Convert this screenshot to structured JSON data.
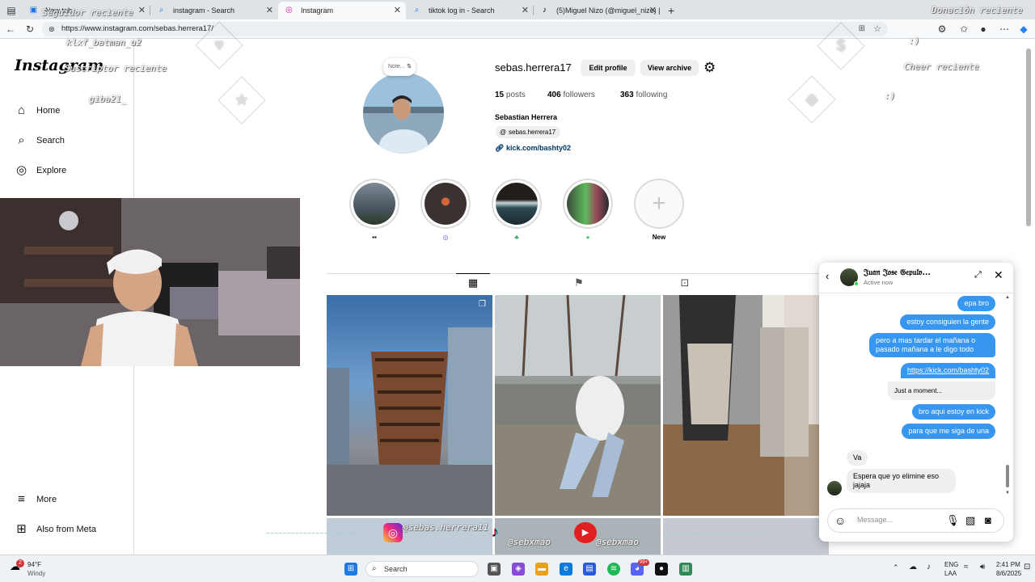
{
  "browser": {
    "tabs": [
      {
        "title": "New tab",
        "icon": "newtab-icon"
      },
      {
        "title": "instagram - Search",
        "icon": "search-icon"
      },
      {
        "title": "Instagram",
        "icon": "instagram-icon",
        "active": true
      },
      {
        "title": "tiktok log in - Search",
        "icon": "search-icon"
      },
      {
        "title": "(5)Miguel Nizo (@miguel_nizo) |",
        "icon": "tiktok-icon"
      }
    ],
    "url": "https://www.instagram.com/sebas.herrera17/"
  },
  "sidebar": {
    "logo": "Instagram",
    "items": [
      {
        "label": "Home",
        "icon": "home-icon"
      },
      {
        "label": "Search",
        "icon": "search-icon"
      },
      {
        "label": "Explore",
        "icon": "compass-icon"
      },
      {
        "label": "More",
        "icon": "hamburger-icon"
      },
      {
        "label": "Also from Meta",
        "icon": "meta-icon"
      }
    ]
  },
  "profile": {
    "note": "Note...",
    "username": "sebas.herrera17",
    "edit_profile": "Edit profile",
    "view_archive": "View archive",
    "posts_count": "15",
    "posts_label": "posts",
    "followers_count": "406",
    "followers_label": "followers",
    "following_count": "363",
    "following_label": "following",
    "full_name": "Sebastian Herrera",
    "threads_handle": "sebas.herrera17",
    "link": "kick.com/bashty02",
    "highlights": [
      {
        "label": "▪▪"
      },
      {
        "label": "◎"
      },
      {
        "label": "♣"
      },
      {
        "label": "●"
      },
      {
        "label": "New"
      }
    ]
  },
  "dm": {
    "contact_name": "𝔍𝔲𝔞𝔫 𝔍𝔬𝔰𝔢 𝔊𝔢𝔭𝔲𝔩𝔳...",
    "status": "Active now",
    "messages": [
      {
        "text": "epa bro",
        "dir": "out"
      },
      {
        "text": "estoy consiguien la gente",
        "dir": "out"
      },
      {
        "text": "pero a mas tardar el mañana o pasado mañana a le digo todo",
        "dir": "out"
      },
      {
        "text": "https://kick.com/bashty02",
        "dir": "out"
      },
      {
        "text": "Just a moment...",
        "dir": "preview"
      },
      {
        "text": "bro aqui estoy en kick",
        "dir": "out"
      },
      {
        "text": "para que me siga de una",
        "dir": "out"
      },
      {
        "text": "Va",
        "dir": "in"
      },
      {
        "text": "Espera que yo elimine eso jajaja",
        "dir": "in"
      }
    ],
    "input_placeholder": "Message..."
  },
  "overlays": {
    "top_left_1": "Seguidor reciente",
    "top_left_2": "klxf_batman_u2",
    "top_left_3": "Suscriptor reciente",
    "top_left_4": "giba21_",
    "top_right_1": "Donación reciente",
    "top_right_2": "Cheer reciente",
    "top_right_3": ":)",
    "top_right_4": ":)",
    "social_instagram": "@sebas.herrera11",
    "social_tiktok": "@sebxmao",
    "social_youtube": "@sebxmao"
  },
  "taskbar": {
    "weather_temp": "94°F",
    "weather_desc": "Windy",
    "weather_badge": "2",
    "search_label": "Search",
    "lang_1": "ENG",
    "lang_2": "LAA",
    "time": "2:41 PM",
    "date": "8/6/2025",
    "discord_badge": "99+"
  }
}
